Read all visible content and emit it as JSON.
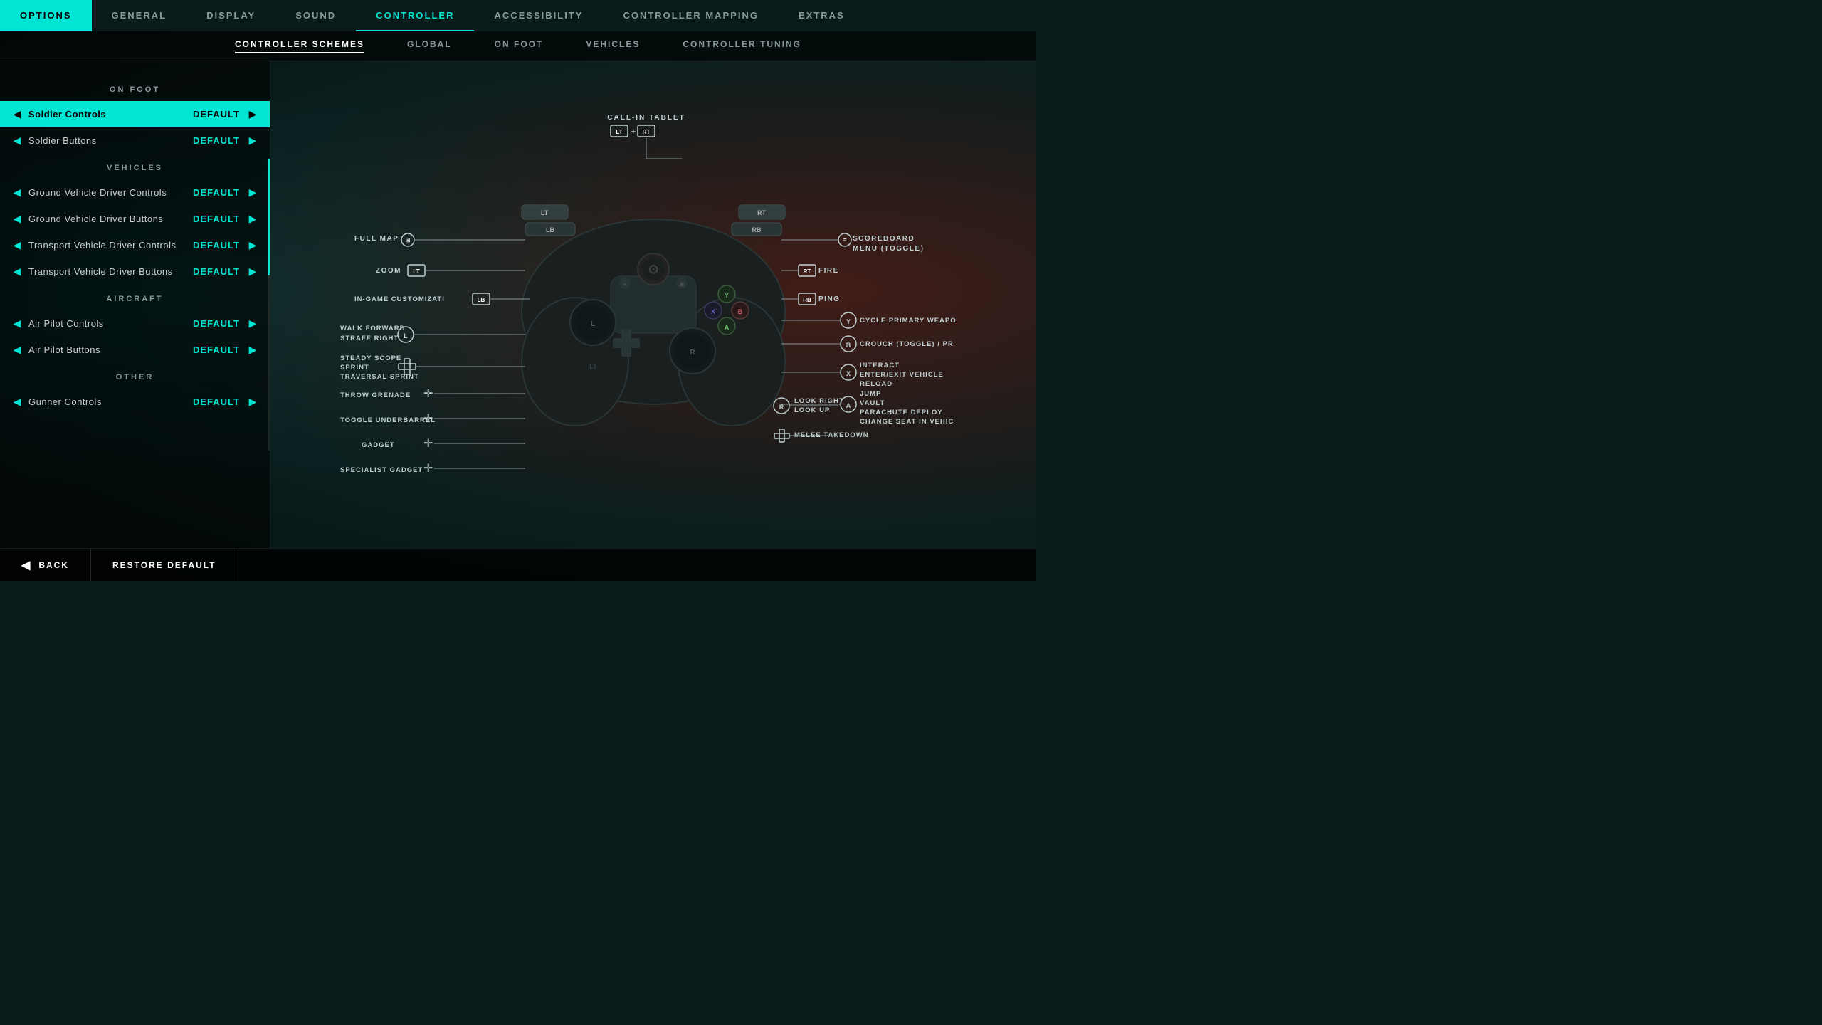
{
  "topNav": {
    "items": [
      {
        "id": "options",
        "label": "OPTIONS",
        "active": false,
        "brand": true
      },
      {
        "id": "general",
        "label": "GENERAL",
        "active": false
      },
      {
        "id": "display",
        "label": "DISPLAY",
        "active": false
      },
      {
        "id": "sound",
        "label": "SOUND",
        "active": false
      },
      {
        "id": "controller",
        "label": "CONTROLLER",
        "active": true
      },
      {
        "id": "accessibility",
        "label": "ACCESSIBILITY",
        "active": false
      },
      {
        "id": "controller-mapping",
        "label": "CONTROLLER MAPPING",
        "active": false
      },
      {
        "id": "extras",
        "label": "EXTRAS",
        "active": false
      }
    ]
  },
  "secondNav": {
    "items": [
      {
        "id": "schemes",
        "label": "CONTROLLER SCHEMES",
        "active": true
      },
      {
        "id": "global",
        "label": "GLOBAL",
        "active": false
      },
      {
        "id": "on-foot",
        "label": "ON FOOT",
        "active": false
      },
      {
        "id": "vehicles",
        "label": "VEHICLES",
        "active": false
      },
      {
        "id": "tuning",
        "label": "CONTROLLER TUNING",
        "active": false
      }
    ]
  },
  "leftPanel": {
    "sections": [
      {
        "header": "ON FOOT",
        "items": [
          {
            "label": "Soldier Controls",
            "value": "DEFAULT",
            "selected": true
          },
          {
            "label": "Soldier Buttons",
            "value": "DEFAULT",
            "selected": false
          }
        ]
      },
      {
        "header": "VEHICLES",
        "items": [
          {
            "label": "Ground Vehicle Driver Controls",
            "value": "DEFAULT",
            "selected": false
          },
          {
            "label": "Ground Vehicle Driver Buttons",
            "value": "DEFAULT",
            "selected": false
          },
          {
            "label": "Transport Vehicle Driver Controls",
            "value": "DEFAULT",
            "selected": false
          },
          {
            "label": "Transport Vehicle Driver Buttons",
            "value": "DEFAULT",
            "selected": false
          }
        ]
      },
      {
        "header": "AIRCRAFT",
        "items": [
          {
            "label": "Air Pilot Controls",
            "value": "DEFAULT",
            "selected": false
          },
          {
            "label": "Air Pilot Buttons",
            "value": "DEFAULT",
            "selected": false
          }
        ]
      },
      {
        "header": "OTHER",
        "items": [
          {
            "label": "Gunner Controls",
            "value": "DEFAULT",
            "selected": false
          }
        ]
      }
    ]
  },
  "rightPanel": {
    "callInTablet": {
      "label": "CALL-IN TABLET",
      "btn1": "LT",
      "plus": "+",
      "btn2": "RT"
    },
    "fullMap": {
      "label": "FULL MAP"
    },
    "scoreboard": {
      "label": "SCOREBOARD\nMENU (TOGGLE)"
    },
    "zoom": {
      "label": "ZOOM",
      "btn": "LT"
    },
    "fire": {
      "label": "FIRE",
      "btn": "RT"
    },
    "inGameCustom": {
      "label": "IN-GAME CUSTOMIZATI",
      "btn": "LB"
    },
    "ping": {
      "label": "PING",
      "btn": "RB"
    },
    "cyclePrimary": {
      "label": "CYCLE PRIMARY WEAPO",
      "btn": "Y"
    },
    "crouch": {
      "label": "CROUCH (TOGGLE) / PR",
      "btn": "B"
    },
    "interact": {
      "label": "INTERACT\nENTER/EXIT VEHICLE\nRELOAD",
      "btn": "X"
    },
    "jump": {
      "label": "JUMP\nVAULT\nPARACHUTE DEPLOY\nCHANGE SEAT IN VEHIC",
      "btn": "A"
    },
    "walkForward": {
      "label": "WALK FORWARD\nSTRAFE RIGHT",
      "btn": "L"
    },
    "steadyScope": {
      "label": "STEADY SCOPE\nSPRINT\nTRAVERSAL SPRINT"
    },
    "throwGrenade": {
      "label": "THROW GRENADE"
    },
    "toggleUnderbarrel": {
      "label": "TOGGLE UNDERBARREL"
    },
    "gadget": {
      "label": "GADGET"
    },
    "specialistGadget": {
      "label": "SPECIALIST GADGET"
    },
    "lookRight": {
      "label": "LOOK RIGHT\nLOOK UP",
      "btn": "R"
    },
    "meleeTakedown": {
      "label": "MELEE TAKEDOWN"
    }
  },
  "bottomBar": {
    "back": "BACK",
    "restoreDefault": "RESTORE DEFAULT"
  }
}
